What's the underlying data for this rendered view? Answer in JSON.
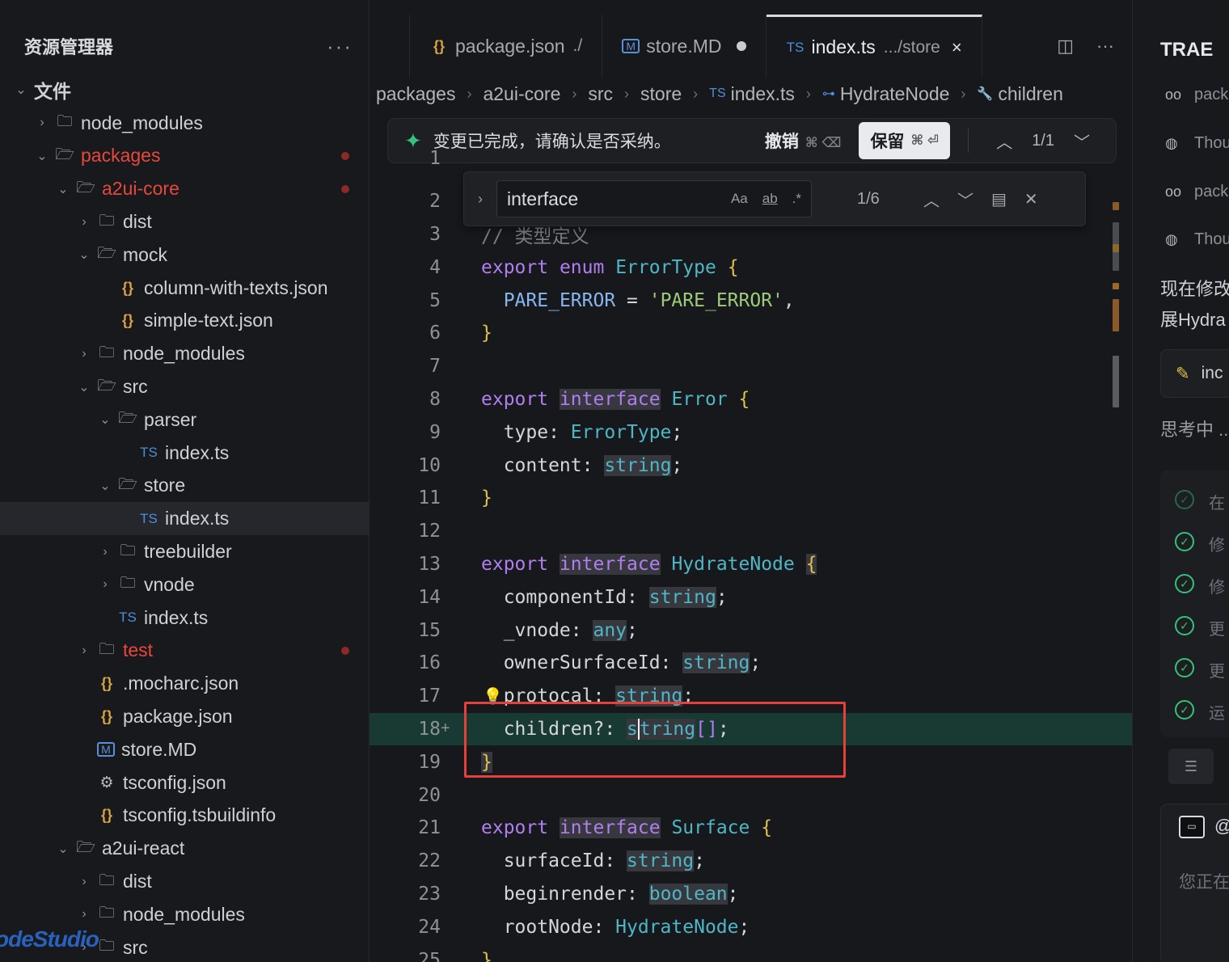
{
  "explorer": {
    "title": "资源管理器",
    "more": "···",
    "items": [
      {
        "label": "文件",
        "indent": 0,
        "chev": "⌄",
        "type": "root"
      },
      {
        "label": "node_modules",
        "indent": 1,
        "chev": "›",
        "type": "folder"
      },
      {
        "label": "packages",
        "indent": 1,
        "chev": "⌄",
        "type": "folder-open",
        "red": true,
        "dot": true
      },
      {
        "label": "a2ui-core",
        "indent": 2,
        "chev": "⌄",
        "type": "folder-open",
        "red": true,
        "dot": true
      },
      {
        "label": "dist",
        "indent": 3,
        "chev": "›",
        "type": "folder"
      },
      {
        "label": "mock",
        "indent": 3,
        "chev": "⌄",
        "type": "folder-open"
      },
      {
        "label": "column-with-texts.json",
        "indent": 4,
        "chev": "",
        "type": "json"
      },
      {
        "label": "simple-text.json",
        "indent": 4,
        "chev": "",
        "type": "json"
      },
      {
        "label": "node_modules",
        "indent": 3,
        "chev": "›",
        "type": "folder"
      },
      {
        "label": "src",
        "indent": 3,
        "chev": "⌄",
        "type": "folder-open"
      },
      {
        "label": "parser",
        "indent": 4,
        "chev": "⌄",
        "type": "folder-open"
      },
      {
        "label": "index.ts",
        "indent": 5,
        "chev": "",
        "type": "ts"
      },
      {
        "label": "store",
        "indent": 4,
        "chev": "⌄",
        "type": "folder-open"
      },
      {
        "label": "index.ts",
        "indent": 5,
        "chev": "",
        "type": "ts",
        "selected": true
      },
      {
        "label": "treebuilder",
        "indent": 4,
        "chev": "›",
        "type": "folder"
      },
      {
        "label": "vnode",
        "indent": 4,
        "chev": "›",
        "type": "folder"
      },
      {
        "label": "index.ts",
        "indent": 4,
        "chev": "",
        "type": "ts"
      },
      {
        "label": "test",
        "indent": 3,
        "chev": "›",
        "type": "folder",
        "red": true,
        "dot": true
      },
      {
        "label": ".mocharc.json",
        "indent": 3,
        "chev": "",
        "type": "json"
      },
      {
        "label": "package.json",
        "indent": 3,
        "chev": "",
        "type": "json"
      },
      {
        "label": "store.MD",
        "indent": 3,
        "chev": "",
        "type": "md"
      },
      {
        "label": "tsconfig.json",
        "indent": 3,
        "chev": "",
        "type": "gear"
      },
      {
        "label": "tsconfig.tsbuildinfo",
        "indent": 3,
        "chev": "",
        "type": "json"
      },
      {
        "label": "a2ui-react",
        "indent": 2,
        "chev": "⌄",
        "type": "folder-open"
      },
      {
        "label": "dist",
        "indent": 3,
        "chev": "›",
        "type": "folder"
      },
      {
        "label": "node_modules",
        "indent": 3,
        "chev": "›",
        "type": "folder"
      },
      {
        "label": "src",
        "indent": 3,
        "chev": "›",
        "type": "folder"
      }
    ],
    "watermark": "odeStudio"
  },
  "tabs": [
    {
      "icon": "{}",
      "label": "package.json",
      "sub": "./",
      "active": false
    },
    {
      "icon": "M",
      "label": "store.MD",
      "sub": "",
      "modified": true,
      "active": false
    },
    {
      "icon": "TS",
      "label": "index.ts",
      "sub": ".../store",
      "active": true,
      "close": "×"
    }
  ],
  "breadcrumbs": [
    "packages",
    "a2ui-core",
    "src",
    "store",
    "index.ts",
    "HydrateNode",
    "children"
  ],
  "notice": {
    "text": "变更已完成，请确认是否采纳。",
    "undo": "撤销",
    "undo_kbd": "⌘ ⌫",
    "keep": "保留",
    "keep_kbd": "⌘ ⏎",
    "counter": "1/1"
  },
  "find": {
    "query": "interface",
    "match_case": "Aa",
    "whole_word": "ab",
    "regex": ".*",
    "count": "1/6"
  },
  "code": [
    {
      "n": "1"
    },
    {
      "n": "2"
    },
    {
      "n": "3",
      "text": "// 类型定义"
    },
    {
      "n": "4",
      "text": "export enum ErrorType {"
    },
    {
      "n": "5",
      "text": "  PARE_ERROR = 'PARE_ERROR',"
    },
    {
      "n": "6",
      "text": "}"
    },
    {
      "n": "7",
      "text": ""
    },
    {
      "n": "8",
      "text": "export interface Error {"
    },
    {
      "n": "9",
      "text": "  type: ErrorType;"
    },
    {
      "n": "10",
      "text": "  content: string;"
    },
    {
      "n": "11",
      "text": "}"
    },
    {
      "n": "12",
      "text": ""
    },
    {
      "n": "13",
      "text": "export interface HydrateNode {"
    },
    {
      "n": "14",
      "text": "  componentId: string;"
    },
    {
      "n": "15",
      "text": "  _vnode: any;"
    },
    {
      "n": "16",
      "text": "  ownerSurfaceId: string;"
    },
    {
      "n": "17",
      "text": "  protocal: string;"
    },
    {
      "n": "18",
      "text": "  children?: string[];"
    },
    {
      "n": "19",
      "text": "}"
    },
    {
      "n": "20",
      "text": ""
    },
    {
      "n": "21",
      "text": "export interface Surface {"
    },
    {
      "n": "22",
      "text": "  surfaceId: string;"
    },
    {
      "n": "23",
      "text": "  beginrender: boolean;"
    },
    {
      "n": "24",
      "text": "  rootNode: HydrateNode;"
    },
    {
      "n": "25",
      "text": "}"
    }
  ],
  "panel": {
    "title": "TRAE",
    "items": [
      "pack",
      "Thou",
      "pack",
      "Thou"
    ],
    "text1": "现在修改",
    "text2": "展Hydra",
    "card": "inc",
    "thinking": "思考中 ..",
    "steps": [
      "在",
      "修",
      "修",
      "更",
      "更",
      "运"
    ],
    "input_at": "@",
    "input_placeholder": "您正在"
  },
  "colors": {
    "accent_green": "#36c27a",
    "modified_red": "#e8473b",
    "highlight_box": "#e6403a"
  }
}
